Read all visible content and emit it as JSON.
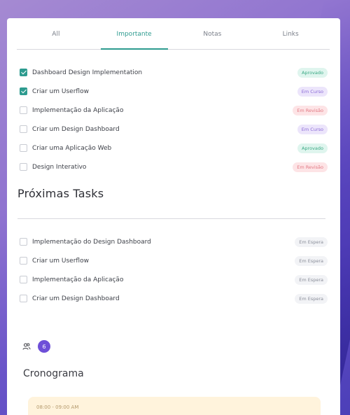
{
  "tabs": [
    {
      "label": "All",
      "active": false
    },
    {
      "label": "Importante",
      "active": true
    },
    {
      "label": "Notas",
      "active": false
    },
    {
      "label": "Links",
      "active": false
    }
  ],
  "important_tasks": [
    {
      "label": "Dashboard Design Implementation",
      "checked": true,
      "status": "Aprovado"
    },
    {
      "label": "Criar um Userflow",
      "checked": true,
      "status": "Em Curso"
    },
    {
      "label": "Implementação da Aplicação",
      "checked": false,
      "status": "Em Revisão"
    },
    {
      "label": "Criar um Design Dashboard",
      "checked": false,
      "status": "Em Curso"
    },
    {
      "label": "Criar uma Aplicação Web",
      "checked": false,
      "status": "Aprovado"
    },
    {
      "label": "Design Interativo",
      "checked": false,
      "status": "Em Revisão"
    }
  ],
  "next_tasks_title": "Próximas Tasks",
  "next_tasks": [
    {
      "label": "Implementação do Design Dashboard",
      "checked": false,
      "status": "Em Espera"
    },
    {
      "label": "Criar um Userflow",
      "checked": false,
      "status": "Em Espera"
    },
    {
      "label": "Implementação da Aplicação",
      "checked": false,
      "status": "Em Espera"
    },
    {
      "label": "Criar um Design Dashboard",
      "checked": false,
      "status": "Em Espera"
    }
  ],
  "participants": {
    "icon": "users-icon",
    "count": "6"
  },
  "schedule": {
    "title": "Cronograma",
    "event_time": "08:00 - 09:00 AM"
  },
  "colors": {
    "accent": "#2d9b8f",
    "count_badge": "#6e4fd8",
    "approved": "#3aa984",
    "in_progress": "#8a6ad6",
    "in_review": "#e27883",
    "waiting": "#8a8e99",
    "event_bg": "#fff3dc"
  }
}
